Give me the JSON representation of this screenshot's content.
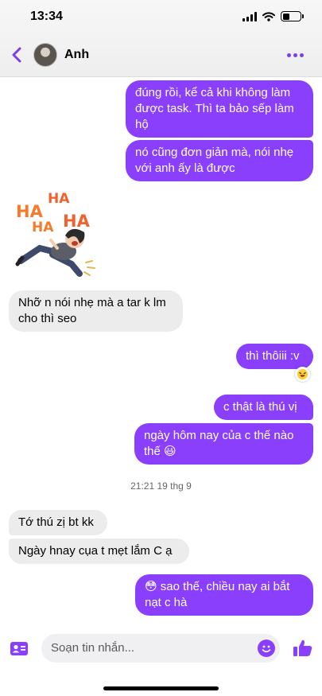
{
  "status_bar": {
    "time": "13:34"
  },
  "header": {
    "contact_name": "Anh"
  },
  "messages": [
    {
      "text": "đúng rồi, kể cả khi không làm được task. Thì ta bảo sếp làm hộ"
    },
    {
      "text": "nó cũng đơn giản mà, nói nhẹ với anh ấy là được"
    },
    {
      "sticker_text": [
        "HA",
        "HA",
        "HA",
        "HA"
      ]
    },
    {
      "text": "Nhỡ n nói nhẹ mà a tar k lm cho thì seo"
    },
    {
      "text": "thì thôiii :v"
    },
    {
      "text": "c thật là thú vị"
    },
    {
      "text": "ngày hôm nay của c thế nào thế 😃"
    },
    {
      "text": "Tớ thú zị bt kk"
    },
    {
      "text": "Ngày hnay cụa t mẹt lắm C ạ"
    },
    {
      "text": "😳 sao thế, chiều nay ai bắt nạt c hà"
    }
  ],
  "timestamp": "21:21 19 thg 9",
  "composer": {
    "placeholder": "Soạn tin nhắn..."
  },
  "colors": {
    "accent": "#8a3ffc",
    "incoming_bubble": "#ececec"
  }
}
